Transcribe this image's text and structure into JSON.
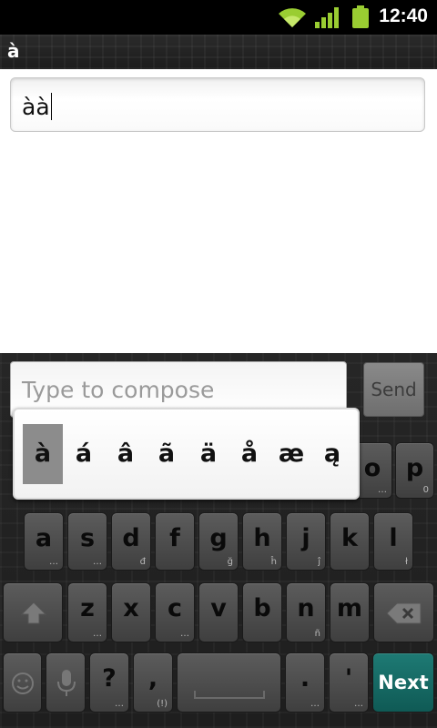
{
  "status_bar": {
    "time": "12:40",
    "icons": [
      "wifi-icon",
      "signal-icon",
      "battery-icon"
    ]
  },
  "title_bar": {
    "title": "à"
  },
  "text_field": {
    "value": "àà"
  },
  "compose": {
    "placeholder": "Type to compose",
    "send_label": "Send"
  },
  "accent_popup": {
    "selected_index": 0,
    "characters": [
      "à",
      "á",
      "â",
      "ã",
      "ä",
      "å",
      "æ",
      "ą"
    ]
  },
  "keyboard": {
    "row1_visible": [
      {
        "label": "o",
        "hint": "…"
      },
      {
        "label": "p",
        "hint": "0"
      }
    ],
    "row2": [
      {
        "label": "a",
        "hint": "…"
      },
      {
        "label": "s",
        "hint": "…"
      },
      {
        "label": "d",
        "hint": "đ"
      },
      {
        "label": "f",
        "hint": ""
      },
      {
        "label": "g",
        "hint": "ğ"
      },
      {
        "label": "h",
        "hint": "ĥ"
      },
      {
        "label": "j",
        "hint": "ĵ"
      },
      {
        "label": "k",
        "hint": ""
      },
      {
        "label": "l",
        "hint": "ł"
      }
    ],
    "row3": [
      {
        "label": "z",
        "hint": "…"
      },
      {
        "label": "x",
        "hint": ""
      },
      {
        "label": "c",
        "hint": "…"
      },
      {
        "label": "v",
        "hint": ""
      },
      {
        "label": "b",
        "hint": ""
      },
      {
        "label": "n",
        "hint": "ñ"
      },
      {
        "label": "m",
        "hint": ""
      }
    ],
    "row4": {
      "question": "?",
      "question_hint": "…",
      "comma": ",",
      "comma_hint": "(!)",
      "period": ".",
      "period_hint": "…",
      "apostrophe": "'",
      "apostrophe_hint": "…",
      "next_label": "Next",
      "next_color": "#0f5a55"
    }
  }
}
